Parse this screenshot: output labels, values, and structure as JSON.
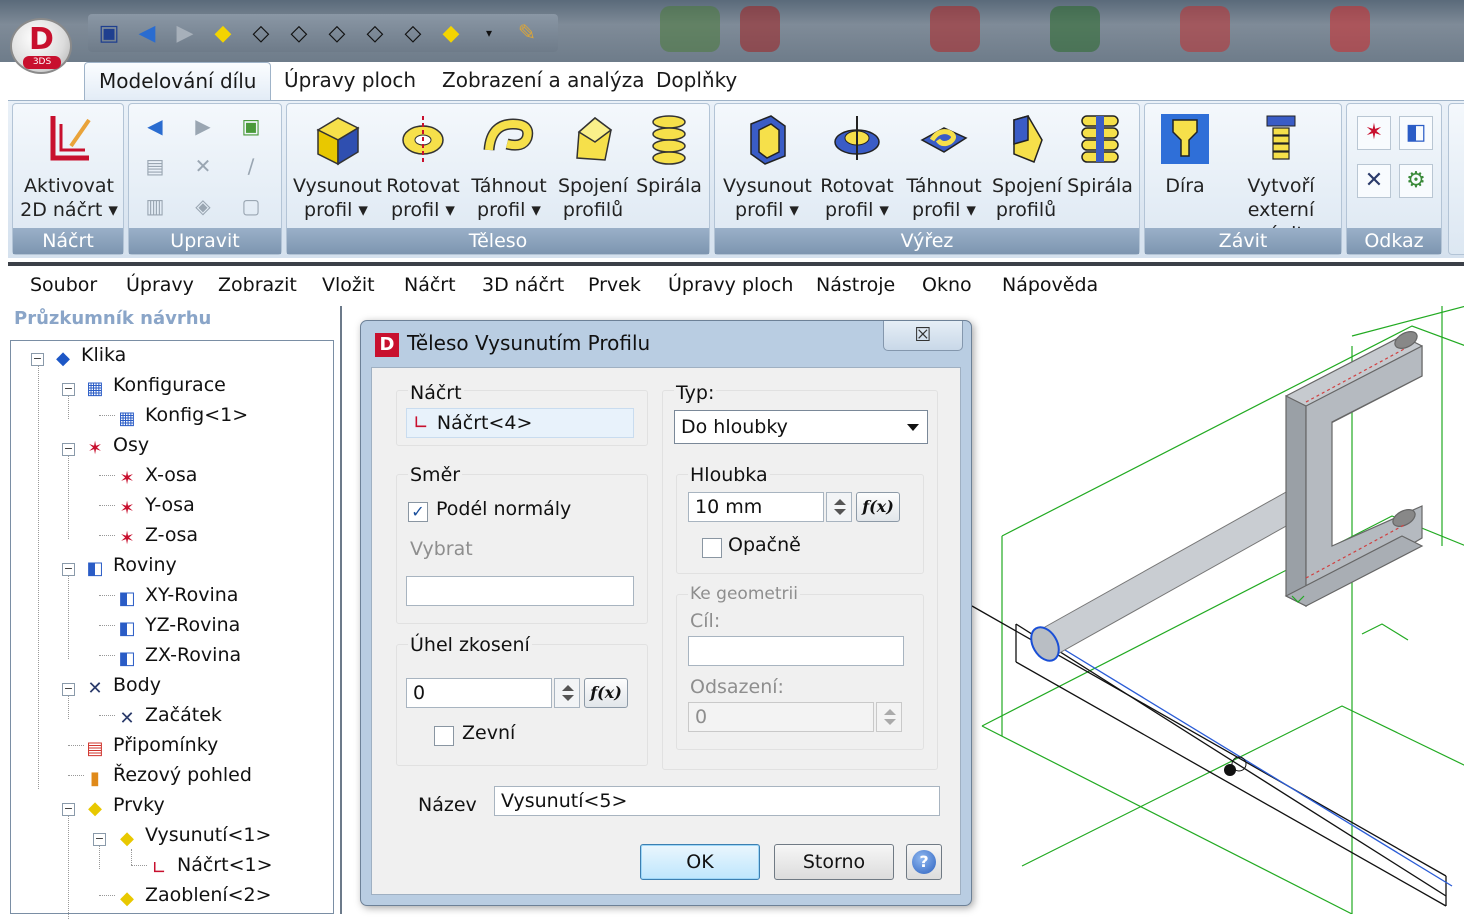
{
  "app": {
    "logo_letter": "D",
    "logo_sub": "3DS"
  },
  "ribbon_tabs": [
    "Modelování dílu",
    "Úpravy ploch",
    "Zobrazení a analýza",
    "Doplňky"
  ],
  "ribbon": {
    "groups": {
      "nacrt": "Náčrt",
      "upravit": "Upravit",
      "teleso": "Těleso",
      "vyrez": "Výřez",
      "zavit": "Závit",
      "odkaz": "Odkaz"
    },
    "buttons": {
      "aktivovat": "Aktivovat 2D náčrt ▾",
      "t_vysunout": "Vysunout profil ▾",
      "t_rotovat": "Rotovat profil ▾",
      "t_tahnout": "Táhnout profil ▾",
      "t_spojeni": "Spojení profilů",
      "t_spirala": "Spirála",
      "v_vysunout": "Vysunout profil ▾",
      "v_rotovat": "Rotovat profil ▾",
      "v_tahnout": "Táhnout profil ▾",
      "v_spojeni": "Spojení profilů",
      "v_spirala": "Spirála",
      "dira": "Díra",
      "externi_zavit": "Vytvoří externí závit"
    }
  },
  "menubar": [
    "Soubor",
    "Úpravy",
    "Zobrazit",
    "Vložit",
    "Náčrt",
    "3D náčrt",
    "Prvek",
    "Úpravy ploch",
    "Nástroje",
    "Okno",
    "Nápověda"
  ],
  "explorer": {
    "title": "Průzkumník návrhu",
    "nodes": [
      "Klika",
      "Konfigurace",
      "Konfig<1>",
      "Osy",
      "X-osa",
      "Y-osa",
      "Z-osa",
      "Roviny",
      "XY-Rovina",
      "YZ-Rovina",
      "ZX-Rovina",
      "Body",
      "Začátek",
      "Připomínky",
      "Řezový pohled",
      "Prvky",
      "Vysunutí<1>",
      "Náčrt<1>",
      "Zaoblení<2>"
    ]
  },
  "dialog": {
    "title": "Těleso Vysunutím Profilu",
    "close": "☒",
    "nacrt_label": "Náčrt",
    "nacrt_value": "Náčrt<4>",
    "typ_label": "Typ:",
    "typ_value": "Do hloubky",
    "smer_label": "Směr",
    "podel_normaly": "Podél normály",
    "podel_normaly_checked": true,
    "vybrat_label": "Vybrat",
    "vybrat_value": "",
    "hloubka_label": "Hloubka",
    "hloubka_value": "10 mm",
    "opacne": "Opačně",
    "opacne_checked": false,
    "fx_label": "f(x)",
    "ke_geometrii": "Ke geometrii",
    "cil_label": "Cíl:",
    "cil_value": "",
    "uhel_label": "Úhel zkosení",
    "uhel_value": "0",
    "zevni": "Zevní",
    "zevni_checked": false,
    "odsazeni_label": "Odsazení:",
    "odsazeni_value": "0",
    "nazev_label": "Název",
    "nazev_value": "Vysunutí<5>",
    "ok": "OK",
    "storno": "Storno",
    "help": "?"
  }
}
